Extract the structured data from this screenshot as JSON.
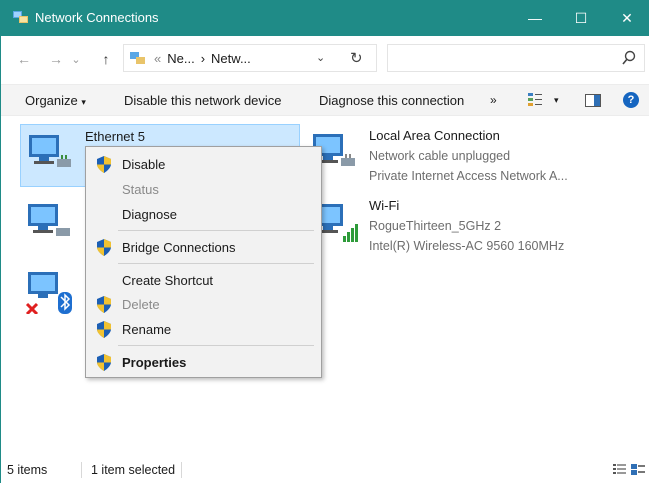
{
  "window": {
    "title": "Network Connections",
    "caption_buttons": {
      "minimize": "—",
      "maximize": "☐",
      "close": "✕"
    },
    "accent_color": "#1f8b87"
  },
  "address": {
    "back": "←",
    "forward": "→",
    "recent": "⌄",
    "up": "↑",
    "overflow": "«",
    "crumbs": [
      "Ne...",
      "›",
      "Netw..."
    ],
    "dropdown": "⌄",
    "refresh": "↻",
    "search_icon": "⚲"
  },
  "toolbar": {
    "organize": "Organize",
    "organize_arrow": "▾",
    "disable_device": "Disable this network device",
    "diagnose": "Diagnose this connection",
    "more": "»",
    "view_arrow": "▾",
    "help": "?"
  },
  "connections": [
    {
      "name": "Ethernet 5",
      "line1": "",
      "line2": "",
      "selected": true
    },
    {
      "name": "Local Area Connection",
      "line1": "Network cable unplugged",
      "line2": "Private Internet Access Network A..."
    },
    {
      "name": "Wi-Fi",
      "line1": "RogueThirteen_5GHz 2",
      "line2": "Intel(R) Wireless-AC 9560 160MHz"
    }
  ],
  "context_menu": {
    "items": [
      {
        "label": "Disable",
        "shield": true,
        "disabled": false,
        "bold": false
      },
      {
        "label": "Status",
        "shield": false,
        "disabled": true,
        "bold": false
      },
      {
        "label": "Diagnose",
        "shield": false,
        "disabled": false,
        "bold": false
      },
      {
        "label": "Bridge Connections",
        "shield": true,
        "disabled": false,
        "bold": false
      },
      {
        "label": "Create Shortcut",
        "shield": false,
        "disabled": false,
        "bold": false
      },
      {
        "label": "Delete",
        "shield": true,
        "disabled": true,
        "bold": false
      },
      {
        "label": "Rename",
        "shield": true,
        "disabled": false,
        "bold": false
      },
      {
        "label": "Properties",
        "shield": true,
        "disabled": false,
        "bold": true
      }
    ]
  },
  "status": {
    "items_count": "5 items",
    "selection": "1 item selected"
  }
}
